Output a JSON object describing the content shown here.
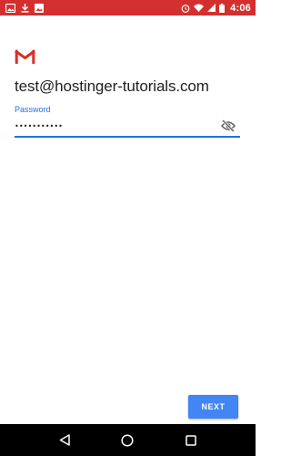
{
  "colors": {
    "status_bar": "#d32f2f",
    "accent": "#1a73e8",
    "button": "#4285f4",
    "nav_bar": "#000000",
    "text_primary": "#212121"
  },
  "status_bar": {
    "left_icons": [
      "gallery-icon",
      "download-icon",
      "image-icon"
    ],
    "right_icons": [
      "alarm-icon",
      "wifi-icon",
      "signal-icon",
      "battery-icon"
    ],
    "time": "4:06"
  },
  "logo": {
    "icon": "gmail-logo-icon"
  },
  "account": {
    "email": "test@hostinger-tutorials.com"
  },
  "password": {
    "label": "Password",
    "value": "•••••••••••",
    "toggle_icon": "visibility-off-icon"
  },
  "actions": {
    "next_label": "NEXT"
  },
  "nav_bar": {
    "buttons": [
      "back-icon",
      "home-icon",
      "recents-icon"
    ]
  }
}
